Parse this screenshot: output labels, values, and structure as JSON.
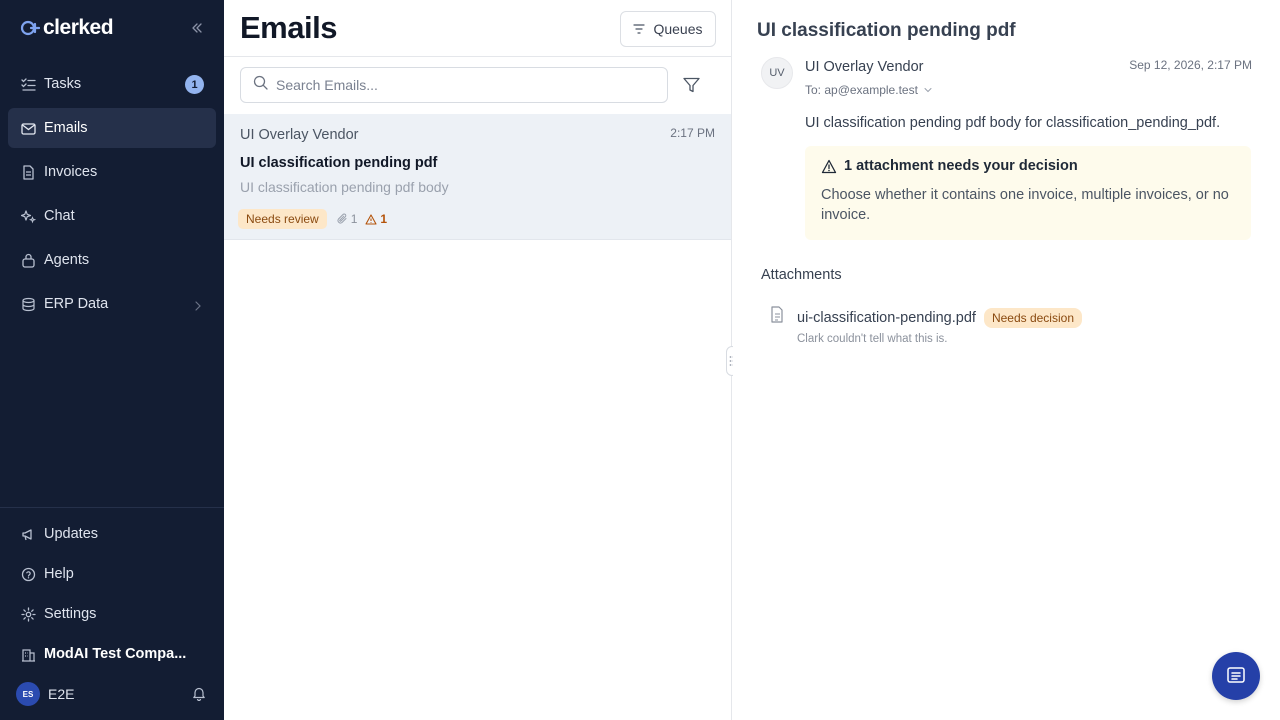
{
  "app": {
    "logo_text": "clerked"
  },
  "sidebar": {
    "items": [
      {
        "label": "Tasks",
        "icon": "tasks-icon",
        "badge": "1"
      },
      {
        "label": "Emails",
        "icon": "mail-icon",
        "active": true
      },
      {
        "label": "Invoices",
        "icon": "file-icon"
      },
      {
        "label": "Chat",
        "icon": "sparkle-icon"
      },
      {
        "label": "Agents",
        "icon": "agent-icon"
      },
      {
        "label": "ERP Data",
        "icon": "database-icon"
      }
    ],
    "bottom": [
      {
        "label": "Updates",
        "icon": "megaphone-icon"
      },
      {
        "label": "Help",
        "icon": "help-circle-icon"
      },
      {
        "label": "Settings",
        "icon": "gear-icon"
      },
      {
        "label": "ModAI Test Compa...",
        "icon": "building-icon"
      }
    ],
    "user": {
      "initials": "ES",
      "name": "E2E"
    }
  },
  "list": {
    "title": "Emails",
    "queues_label": "Queues",
    "search_placeholder": "Search Emails...",
    "emails": [
      {
        "sender": "UI Overlay Vendor",
        "time": "2:17 PM",
        "subject": "UI classification pending pdf",
        "preview": "UI classification pending pdf body",
        "status": "Needs review",
        "attachments": "1",
        "warnings": "1"
      }
    ]
  },
  "detail": {
    "subject": "UI classification pending pdf",
    "sender_initials": "UV",
    "sender": "UI Overlay Vendor",
    "to": "To: ap@example.test",
    "date": "Sep 12, 2026, 2:17 PM",
    "body": "UI classification pending pdf body for classification_pending_pdf.",
    "alert": {
      "title": "1 attachment needs your decision",
      "text": "Choose whether it contains one invoice, multiple invoices, or no invoice."
    },
    "attachments_heading": "Attachments",
    "attachments": [
      {
        "name": "ui-classification-pending.pdf",
        "status": "Needs decision",
        "note": "Clark couldn't tell what this is."
      }
    ]
  },
  "colors": {
    "sidebar_bg": "#131d33",
    "accent": "#2540a8",
    "warning_bg": "#fde7c8",
    "alert_bg": "#fefbec"
  }
}
